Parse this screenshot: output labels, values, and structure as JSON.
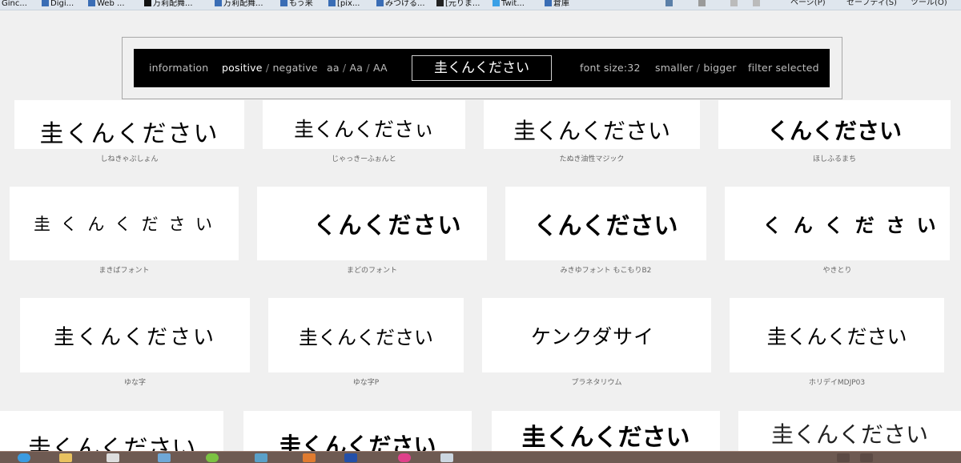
{
  "browser": {
    "bookmarks": [
      "Ginc...",
      "Digi...",
      "Web ...",
      "万莉配舞...",
      "万莉配舞...",
      "もう来",
      "[pix...",
      "みつける...",
      "[元りま...",
      "Twit...",
      "倉庫"
    ],
    "tools": [
      "ページ(P)",
      "セーフティ(S)",
      "ツール(O)"
    ]
  },
  "toolbar": {
    "information": "information",
    "positive": "positive",
    "slash": "/",
    "negative": "negative",
    "aa": "aa",
    "Aa": "Aa",
    "AA": "AA",
    "sample_text": "圭くんください",
    "font_size": "font size:32",
    "smaller": "smaller",
    "bigger": "bigger",
    "filter_selected": "filter selected"
  },
  "fonts": [
    {
      "sample": "圭くんください",
      "name": "しねきゃぷしょん"
    },
    {
      "sample": "圭くんくださぃ",
      "name": "じゃっきーふぉんと"
    },
    {
      "sample": "圭くんください",
      "name": "たぬき油性マジック"
    },
    {
      "sample": "くんください",
      "name": "ほしふるまち"
    },
    {
      "sample": "圭 く ん く だ さ い",
      "name": "まきばフォント"
    },
    {
      "sample": "くんください",
      "name": "まどのフォント"
    },
    {
      "sample": "くんください",
      "name": "みきゆフォント もこもりB2"
    },
    {
      "sample": "く ん く だ さ い",
      "name": "やきとり"
    },
    {
      "sample": "圭くんください",
      "name": "ゆな字"
    },
    {
      "sample": "圭くんください",
      "name": "ゆな字P"
    },
    {
      "sample": "ケンクダサイ",
      "name": "プラネタリウム"
    },
    {
      "sample": "圭くんください",
      "name": "ホリデイMDJP03"
    },
    {
      "sample": "圭くんください",
      "name": ""
    },
    {
      "sample": "圭くんください",
      "name": ""
    },
    {
      "sample": "圭くんください",
      "name": ""
    },
    {
      "sample": "圭くんください",
      "name": ""
    }
  ]
}
